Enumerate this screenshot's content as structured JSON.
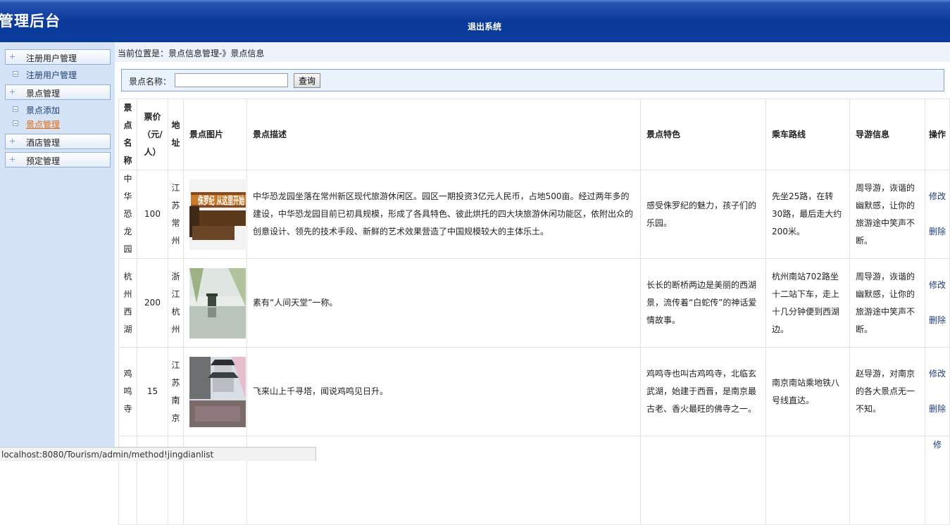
{
  "header": {
    "title": "管理后台",
    "logout": "退出系统"
  },
  "sidebar": {
    "sections": [
      {
        "label": "注册用户管理",
        "items": [
          {
            "label": "注册用户管理",
            "active": false
          }
        ]
      },
      {
        "label": "景点管理",
        "items": [
          {
            "label": "景点添加",
            "active": false
          },
          {
            "label": "景点管理",
            "active": true
          }
        ]
      },
      {
        "label": "酒店管理",
        "items": []
      },
      {
        "label": "预定管理",
        "items": []
      }
    ]
  },
  "breadcrumb": "当前位置是：景点信息管理-》景点信息",
  "search": {
    "label": "景点名称：",
    "value": "",
    "button": "查询"
  },
  "table": {
    "headers": [
      "景点名称",
      "票价（元/人）",
      "地址",
      "景点图片",
      "景点描述",
      "景点特色",
      "乘车路线",
      "导游信息",
      "操作"
    ],
    "rows": [
      {
        "name": "中华恐龙园",
        "price": "100",
        "address": "江苏常州",
        "image_text": "侏罗纪 从这里开始",
        "description": "中华恐龙园坐落在常州新区现代旅游休闲区。园区一期投资3亿元人民币，占地500亩。经过两年多的建设，中华恐龙园目前已初具规模，形成了各具特色、彼此烘托的四大块旅游休闲功能区，依附出众的创意设计、领先的技术手段、新鲜的艺术效果营造了中国规模较大的主体乐土。",
        "feature": "感受侏罗纪的魅力，孩子们的乐园。",
        "route": "先坐25路，在转30路，最后走大约200米。",
        "guide": "周导游，诙谐的幽默感，让你的旅游途中笑声不断。"
      },
      {
        "name": "杭州西湖",
        "price": "200",
        "address": "浙江杭州",
        "description": "素有“人间天堂”一称。",
        "feature": "长长的断桥两边是美丽的西湖景，流传着“白蛇传”的神话爱情故事。",
        "route": "杭州南站702路坐十二站下车，走上十几分钟便到西湖边。",
        "guide": "周导游，诙谐的幽默感，让你的旅游途中笑声不断。"
      },
      {
        "name": "鸡鸣寺",
        "price": "15",
        "address": "江苏南京",
        "description": "飞来山上千寻塔，闻说鸡鸣见日升。",
        "feature": "鸡鸣寺也叫古鸡鸣寺，北临玄武湖，始建于西晋，是南京最古老、香火最旺的佛寺之一。",
        "route": "南京南站乘地铁八号线直达。",
        "guide": "赵导游，对南京的各大景点无一不知。"
      }
    ],
    "actions": {
      "edit": "修改",
      "delete": "删除"
    },
    "partial_row_action": "修"
  },
  "statusbar": "localhost:8080/Tourism/admin/method!jingdianlist"
}
